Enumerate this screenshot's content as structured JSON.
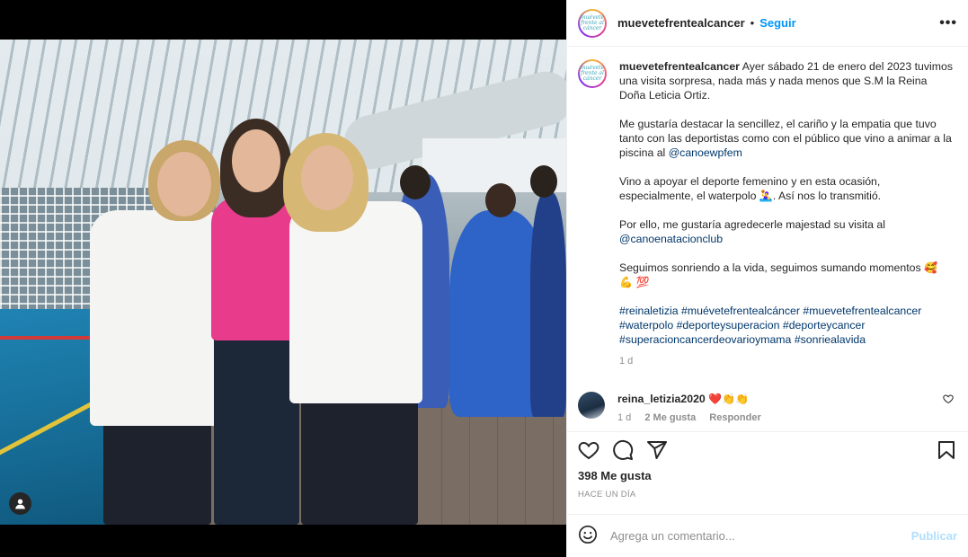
{
  "post": {
    "username": "muevetefrentealcancer",
    "avatar_text": "muévete frente al cáncer",
    "follow_label": "Seguir",
    "dot": "•",
    "more_label": "•••"
  },
  "caption": {
    "username": "muevetefrentealcancer",
    "p1": "Ayer sábado 21 de enero del 2023 tuvimos una visita sorpresa, nada más y nada menos que S.M la Reina Doña Leticia Ortiz.",
    "p2_text": "Me gustaría destacar la sencillez, el cariño y la empatia que tuvo tanto con las deportistas como con el público que vino a animar a la piscina al ",
    "p2_link": "@canoewpfem",
    "p3_a": "Vino a apoyar el deporte femenino y en esta ocasión, especialmente, el waterpolo ",
    "p3_emoji": "🤽‍♀️",
    "p3_b": ". Así nos lo transmitió.",
    "p4_text": "Por ello, me gustaría agredecerle majestad su visita al ",
    "p4_link": "@canoenatacionclub",
    "p5_text": "Seguimos sonriendo a la vida, seguimos sumando momentos ",
    "p5_emoji": "🥰 💪 💯",
    "hashtags": [
      "#reinaletizia",
      "#muévetefrentealcáncer",
      "#muevetefrentealcancer",
      "#waterpolo",
      "#deporteysuperacion",
      "#deporteycancer",
      "#superacioncancerdeovarioymama",
      "#sonriealavida"
    ],
    "time": "1 d"
  },
  "comment": {
    "username": "reina_letizia2020",
    "text": "❤️👏👏",
    "time": "1 d",
    "likes": "2 Me gusta",
    "reply": "Responder"
  },
  "stats": {
    "likes": "398 Me gusta",
    "ago": "HACE UN DÍA"
  },
  "add_comment": {
    "placeholder": "Agrega un comentario...",
    "post_label": "Publicar"
  },
  "icons": {
    "like": "heart-icon",
    "comment": "comment-icon",
    "share": "share-icon",
    "save": "bookmark-icon",
    "emoji": "emoji-icon",
    "tag": "user-tag-icon",
    "more": "more-icon"
  }
}
